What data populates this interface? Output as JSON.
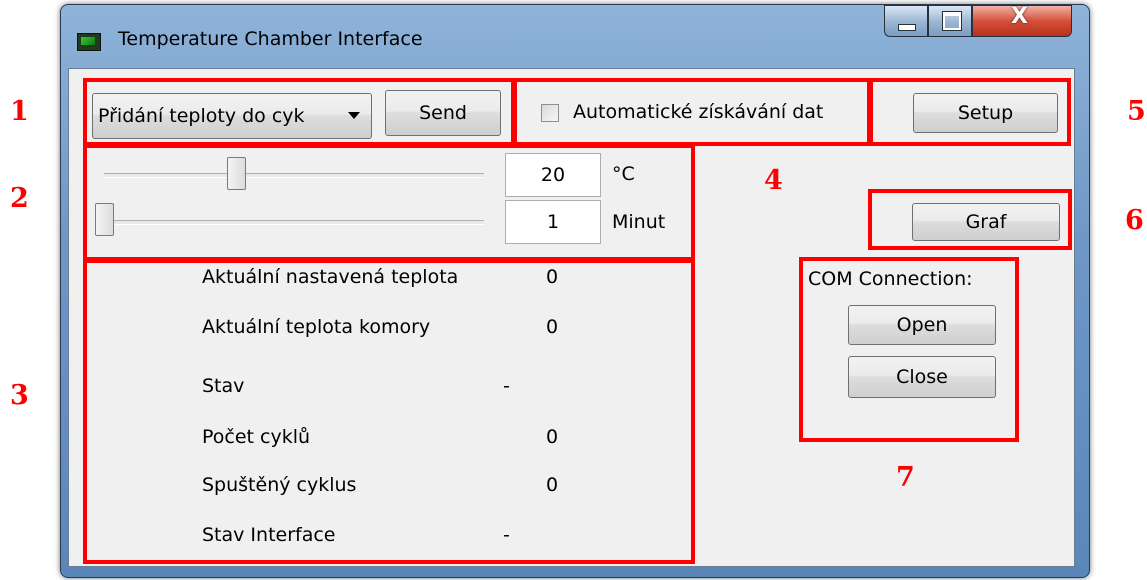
{
  "window": {
    "title": "Temperature Chamber Interface",
    "close_glyph": "X"
  },
  "toolbar": {
    "combo_value": "Přidání teploty do cyk",
    "send_label": "Send",
    "auto_checkbox_label": "Automatické získávání dat",
    "auto_checked": false,
    "setup_label": "Setup"
  },
  "sliders": {
    "temperature_value": "20",
    "temperature_unit": "°C",
    "minutes_value": "1",
    "minutes_unit": "Minut"
  },
  "status": {
    "rows": [
      {
        "label": "Aktuální nastavená teplota",
        "value": "0"
      },
      {
        "label": "Aktuální teplota komory",
        "value": "0"
      },
      {
        "label": "Stav",
        "value": "-"
      },
      {
        "label": "Počet cyklů",
        "value": "0"
      },
      {
        "label": "Spuštěný cyklus",
        "value": "0"
      },
      {
        "label": "Stav Interface",
        "value": "-"
      }
    ]
  },
  "graph": {
    "label": "Graf"
  },
  "com": {
    "title": "COM Connection:",
    "open_label": "Open",
    "close_label": "Close"
  },
  "annotations": [
    "1",
    "2",
    "3",
    "4",
    "5",
    "6",
    "7"
  ],
  "colors": {
    "annotation_red": "#ff0000",
    "client_bg": "#f0f0f0",
    "titlebar_blue": "#6f98c8"
  }
}
